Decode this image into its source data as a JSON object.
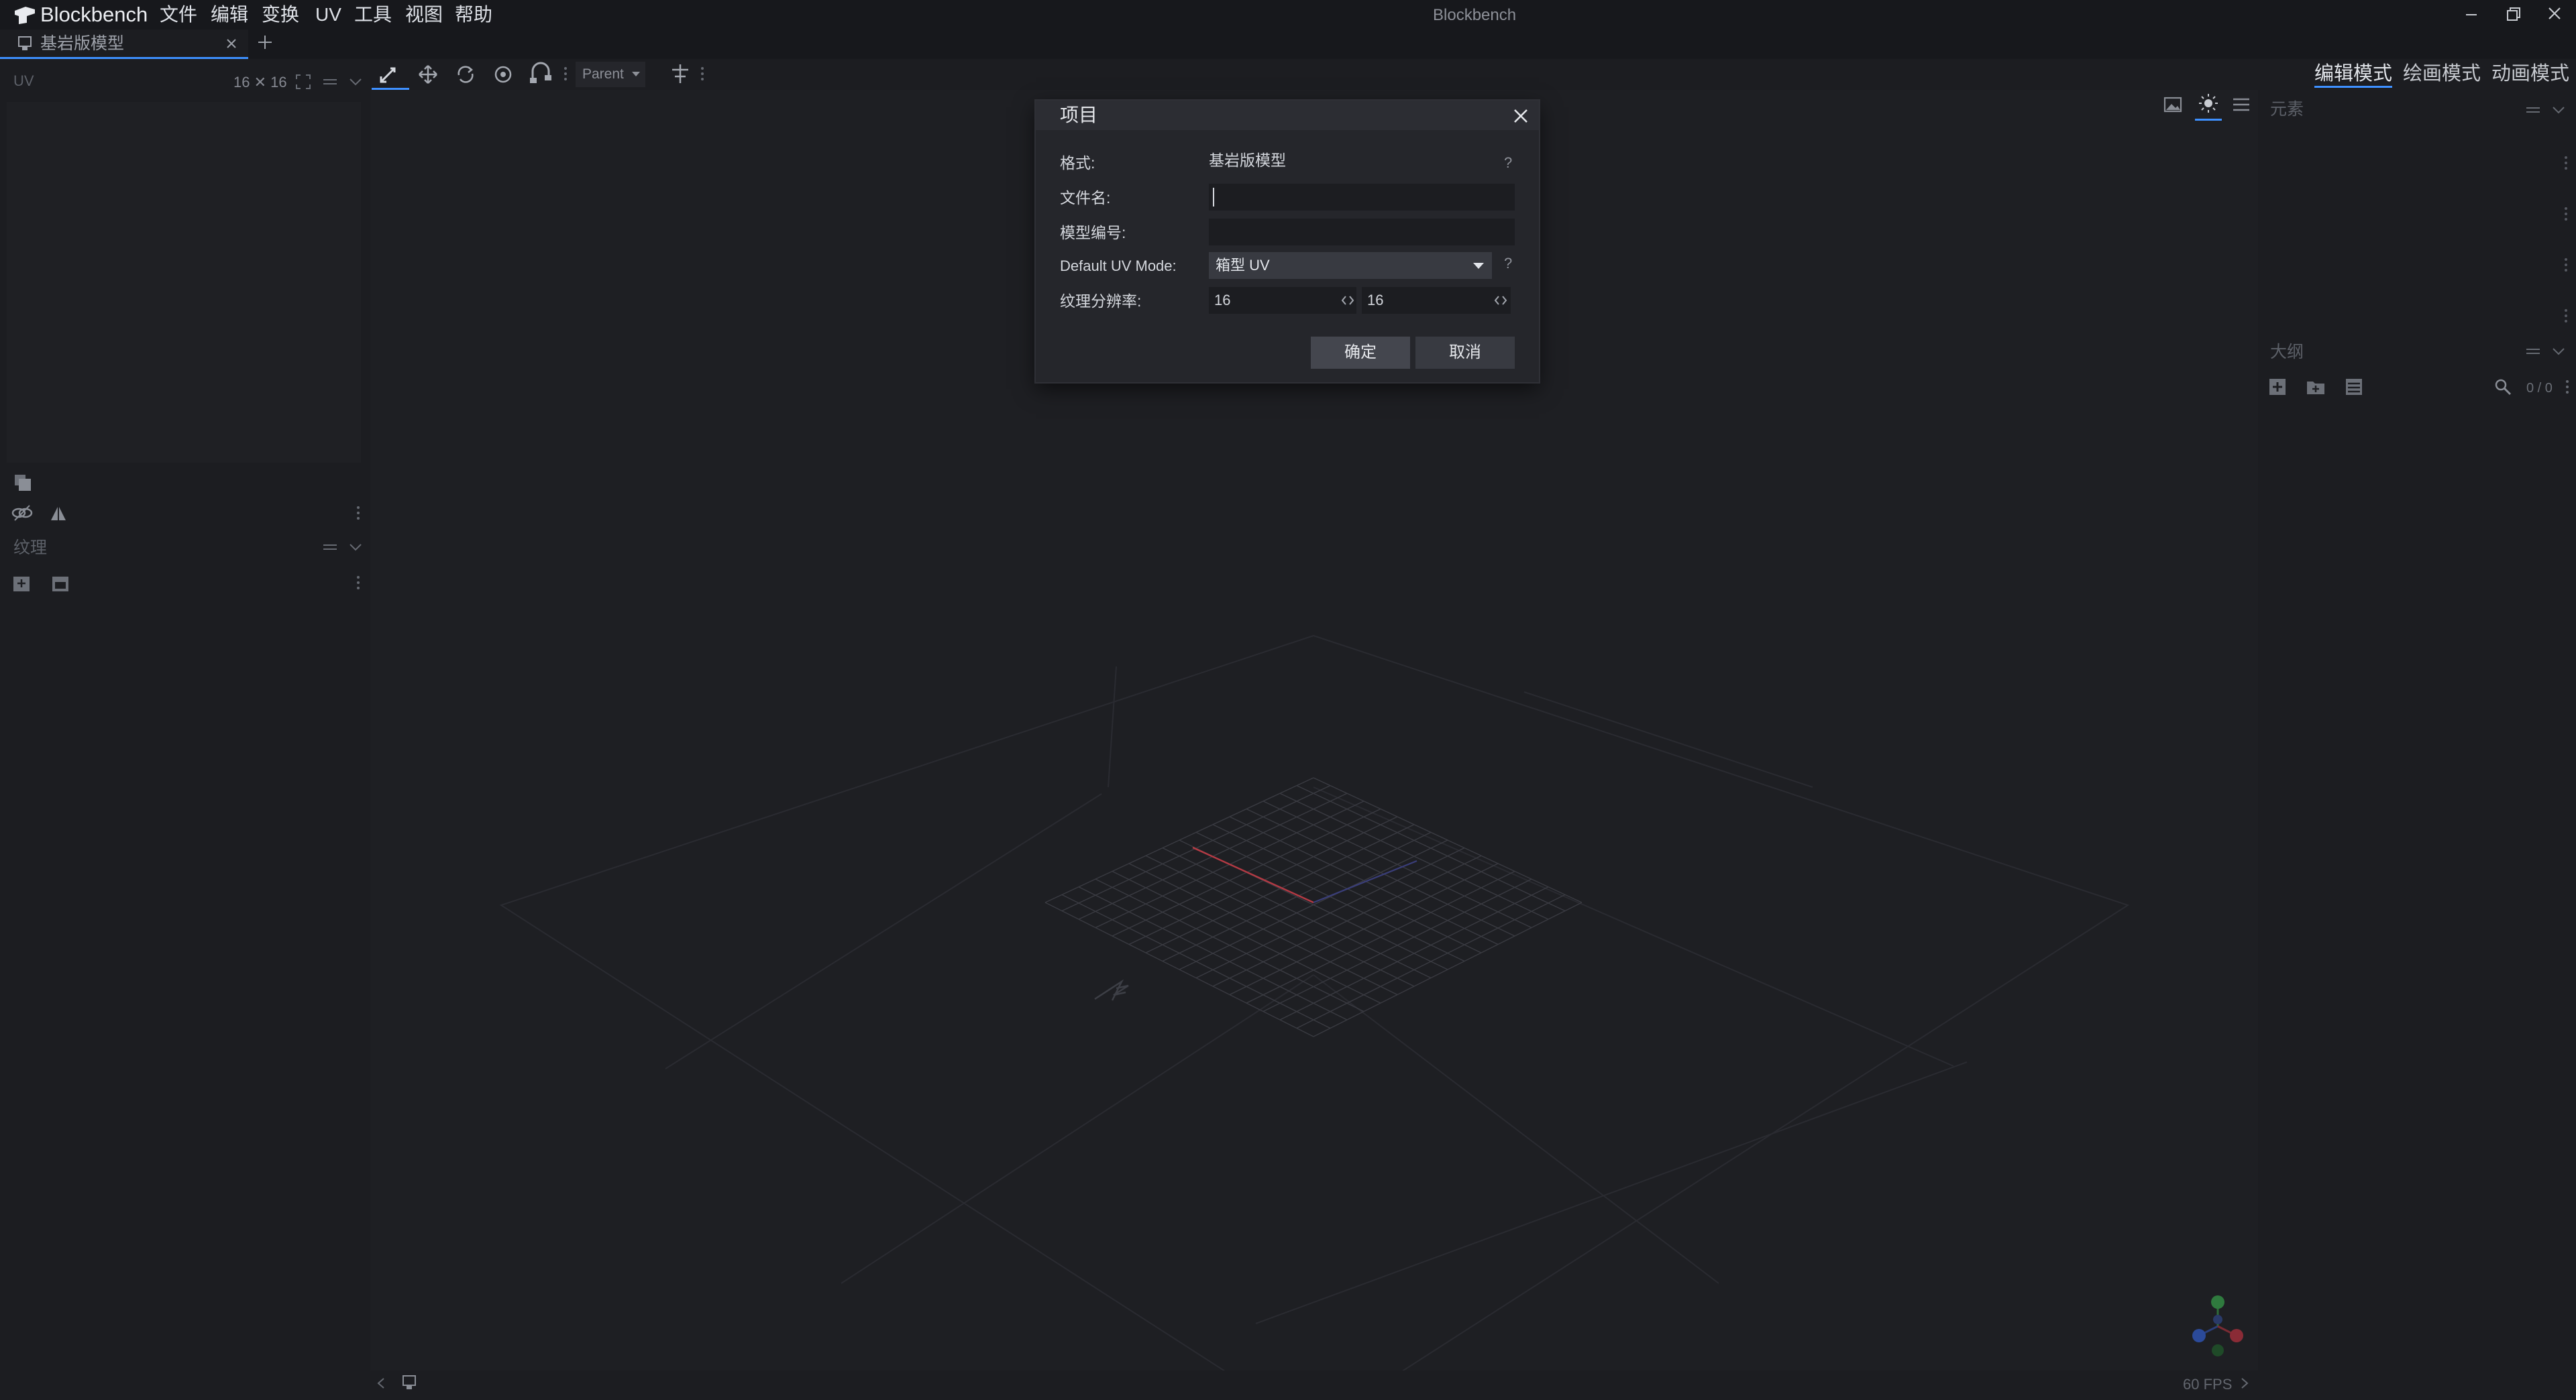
{
  "titlebar": {
    "app_name": "Blockbench",
    "window_title": "Blockbench",
    "menu": [
      "文件",
      "编辑",
      "变换",
      "UV",
      "工具",
      "视图",
      "帮助"
    ]
  },
  "tabs": [
    {
      "label": "基岩版模型"
    }
  ],
  "left_panel": {
    "uv_title": "UV",
    "uv_size": "16 ✕ 16",
    "textures_title": "纹理"
  },
  "toolbar": {
    "pivot_select": "Parent"
  },
  "modes": [
    "编辑模式",
    "绘画模式",
    "动画模式"
  ],
  "right_panel": {
    "elements_title": "元素",
    "outliner_title": "大纲",
    "outliner_count": "0 / 0"
  },
  "dialog": {
    "title": "项目",
    "format_label": "格式:",
    "format_value": "基岩版模型",
    "help": "?",
    "filename_label": "文件名:",
    "filename_value": "",
    "model_id_label": "模型编号:",
    "model_id_value": "",
    "uv_mode_label": "Default UV Mode:",
    "uv_mode_value": "箱型 UV",
    "resolution_label": "纹理分辨率:",
    "resolution_w": "16",
    "resolution_h": "16",
    "confirm": "确定",
    "cancel": "取消"
  },
  "status": {
    "fps": "60 FPS"
  },
  "colors": {
    "accent": "#3e90ff",
    "background": "#1c1d21",
    "dialog": "#25262b"
  }
}
